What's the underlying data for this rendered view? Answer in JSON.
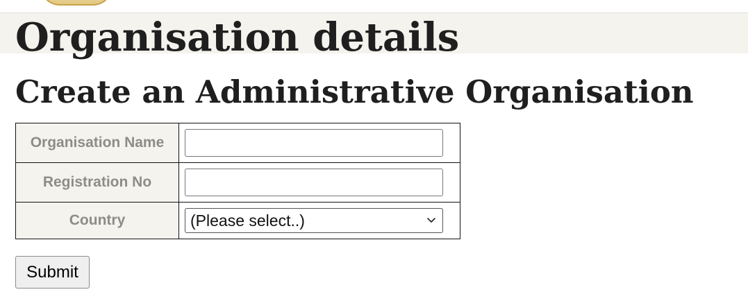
{
  "header": {
    "logo_icon": "emblem-logo-icon",
    "title": "Organisation details"
  },
  "main": {
    "heading": "Create an Administrative Organisation",
    "form": {
      "fields": [
        {
          "label": "Organisation Name",
          "value": "",
          "placeholder": ""
        },
        {
          "label": "Registration No",
          "value": "",
          "placeholder": ""
        },
        {
          "label": "Country",
          "selected": "(Please select..)",
          "icon": "chevron-down-icon"
        }
      ],
      "submit_label": "Submit"
    }
  },
  "colors": {
    "header_band": "#f4f3ee",
    "label_cell_bg": "#f4f3ee",
    "label_text": "#8d8d88",
    "title_text": "#1f1f1f",
    "logo_gold": "#c9a24a"
  }
}
